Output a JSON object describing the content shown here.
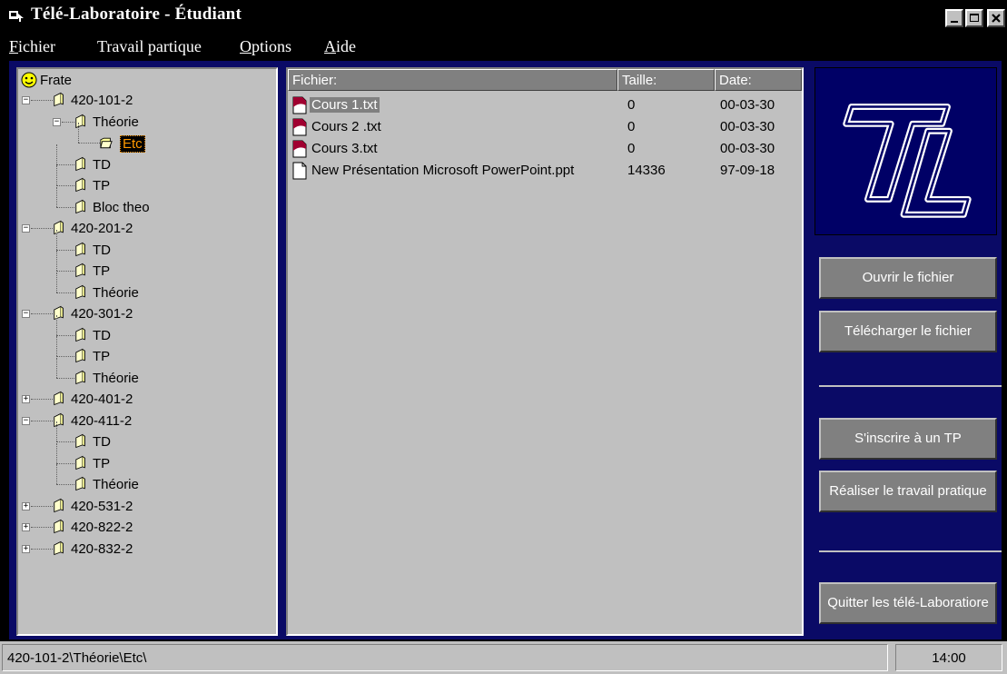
{
  "window": {
    "title": "Télé-Laboratoire - Étudiant"
  },
  "menu": {
    "items": [
      {
        "underline": "F",
        "rest": "ichier"
      },
      {
        "underline": "",
        "rest": "Travail partique"
      },
      {
        "underline": "O",
        "rest": "ptions"
      },
      {
        "underline": "A",
        "rest": "ide"
      }
    ]
  },
  "tree": {
    "root_label": "Frate",
    "nodes": [
      {
        "label": "420-101-2",
        "level": 1,
        "expander": "minus"
      },
      {
        "label": "Théorie",
        "level": 2,
        "expander": "minus"
      },
      {
        "label": "Etc",
        "level": 3,
        "expander": "",
        "selected": true,
        "open": true
      },
      {
        "label": "TD",
        "level": 2,
        "expander": ""
      },
      {
        "label": "TP",
        "level": 2,
        "expander": ""
      },
      {
        "label": "Bloc theo",
        "level": 2,
        "expander": ""
      },
      {
        "label": "420-201-2",
        "level": 1,
        "expander": "minus"
      },
      {
        "label": "TD",
        "level": 2,
        "expander": ""
      },
      {
        "label": "TP",
        "level": 2,
        "expander": ""
      },
      {
        "label": "Théorie",
        "level": 2,
        "expander": ""
      },
      {
        "label": "420-301-2",
        "level": 1,
        "expander": "minus"
      },
      {
        "label": "TD",
        "level": 2,
        "expander": ""
      },
      {
        "label": "TP",
        "level": 2,
        "expander": ""
      },
      {
        "label": "Théorie",
        "level": 2,
        "expander": ""
      },
      {
        "label": "420-401-2",
        "level": 1,
        "expander": "plus"
      },
      {
        "label": "420-411-2",
        "level": 1,
        "expander": "minus"
      },
      {
        "label": "TD",
        "level": 2,
        "expander": ""
      },
      {
        "label": "TP",
        "level": 2,
        "expander": ""
      },
      {
        "label": "Théorie",
        "level": 2,
        "expander": ""
      },
      {
        "label": "420-531-2",
        "level": 1,
        "expander": "plus"
      },
      {
        "label": "420-822-2",
        "level": 1,
        "expander": "plus"
      },
      {
        "label": "420-832-2",
        "level": 1,
        "expander": "plus"
      }
    ]
  },
  "files": {
    "columns": [
      "Fichier:",
      "Taille:",
      "Date:"
    ],
    "rows": [
      {
        "name": "Cours 1.txt",
        "size": "0",
        "date": "00-03-30",
        "icon": "red-document-icon",
        "selected": true
      },
      {
        "name": "Cours 2 .txt",
        "size": "0",
        "date": "00-03-30",
        "icon": "red-document-icon"
      },
      {
        "name": "Cours 3.txt",
        "size": "0",
        "date": "00-03-30",
        "icon": "red-document-icon"
      },
      {
        "name": "New Présentation Microsoft PowerPoint.ppt",
        "size": "14336",
        "date": "97-09-18",
        "icon": "blank-document-icon"
      }
    ]
  },
  "actions": {
    "open_file": "Ouvrir le fichier",
    "download_file": "Télécharger le fichier",
    "register_tp": "S'inscrire à un TP",
    "do_tp": "Réaliser le travail pratique",
    "quit": "Quitter les télé-Laboratiore"
  },
  "logo_text": "TL",
  "status": {
    "path": "420-101-2\\Théorie\\Etc\\",
    "time": "14:00"
  },
  "colors": {
    "client_bg": "#0a0a66",
    "panel_bg": "#c0c0c0",
    "selected_folder": "#ff9900",
    "document_red": "#a00030"
  }
}
